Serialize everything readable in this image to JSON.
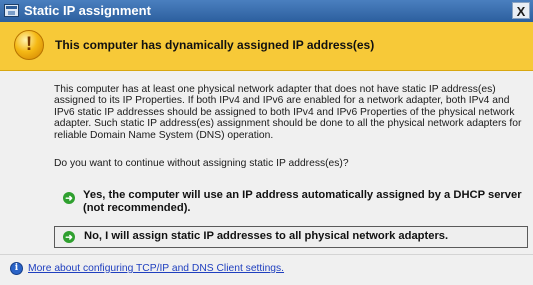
{
  "window": {
    "title": "Static IP assignment",
    "close_label": "X"
  },
  "banner": {
    "icon": "warning-shield-icon",
    "title": "This computer has dynamically assigned IP address(es)"
  },
  "body": {
    "paragraph": "This computer has at least one physical network adapter that does not have static IP address(es) assigned to its IP Properties. If both IPv4 and IPv6 are enabled for a network adapter, both IPv4 and IPv6 static IP addresses should be assigned to both IPv4 and IPv6 Properties of the physical network adapter. Such static IP address(es) assignment should be done to all the physical network adapters for reliable Domain Name System (DNS) operation.",
    "question": "Do you want to continue without assigning static IP address(es)?"
  },
  "options": [
    {
      "icon": "green-arrow-icon",
      "label": "Yes, the computer will use an IP address automatically assigned by a DHCP server (not recommended)."
    },
    {
      "icon": "green-arrow-icon",
      "label": "No, I will assign static IP addresses to all physical network adapters."
    }
  ],
  "footer": {
    "icon": "info-icon",
    "link": "More about configuring TCP/IP and DNS Client settings."
  },
  "colors": {
    "titlebar": "#2c5f9e",
    "banner": "#f7c938",
    "link": "#1f3fbf",
    "arrow": "#2fa02f"
  }
}
